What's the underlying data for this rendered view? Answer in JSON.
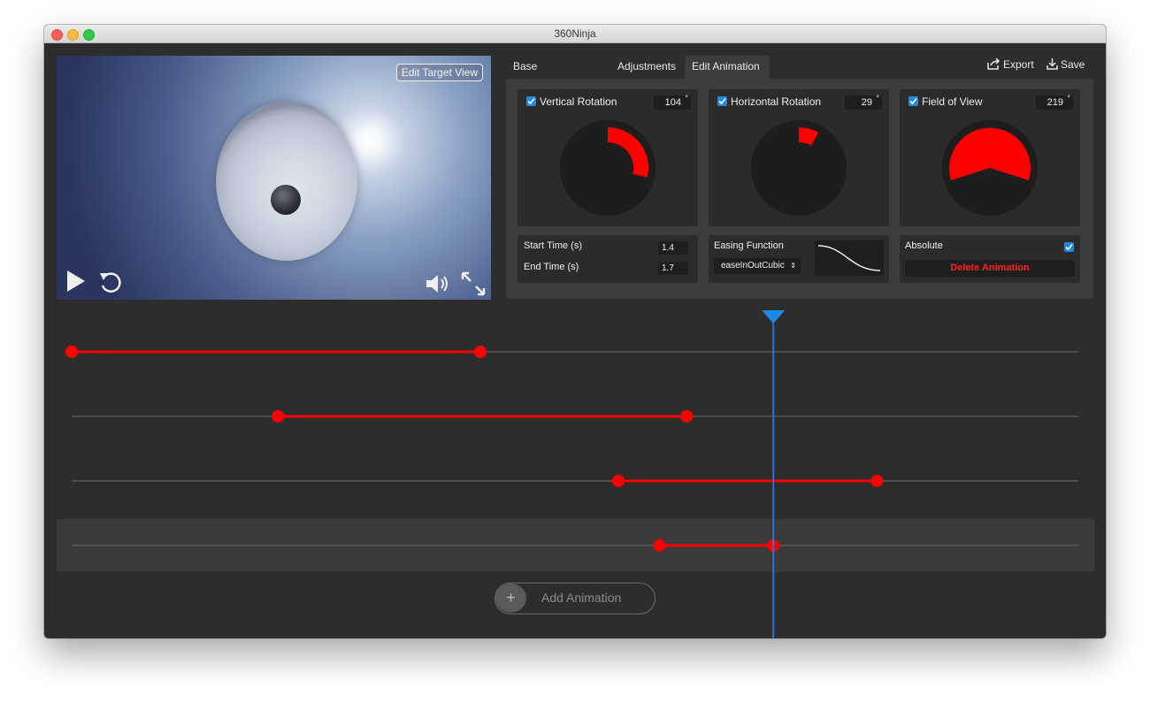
{
  "window": {
    "title": "360Ninja"
  },
  "preview": {
    "edit_target_label": "Edit Target View"
  },
  "tabs": [
    {
      "label": "Base Configuration",
      "active": false
    },
    {
      "label": "Adjustments",
      "active": false
    },
    {
      "label": "Edit Animation",
      "active": true
    }
  ],
  "header_actions": {
    "export_label": "Export",
    "save_label": "Save"
  },
  "dials": [
    {
      "label": "Vertical Rotation",
      "value": "104",
      "unit": "°",
      "checked": true
    },
    {
      "label": "Horizontal Rotation",
      "value": "29",
      "unit": "°",
      "checked": true
    },
    {
      "label": "Field of View",
      "value": "219",
      "unit": "°",
      "checked": true
    }
  ],
  "timing": {
    "start_label": "Start Time (s)",
    "start_value": "1.4",
    "end_label": "End Time (s)",
    "end_value": "1.7"
  },
  "easing": {
    "label": "Easing Function",
    "selected": "easeInOutCubic"
  },
  "absolute": {
    "label": "Absolute",
    "checked": true,
    "delete_label": "Delete Animation"
  },
  "timeline": {
    "playhead_fraction": 0.697,
    "selected_track": 3,
    "tracks": [
      {
        "start": 0.0,
        "end": 0.406
      },
      {
        "start": 0.205,
        "end": 0.611
      },
      {
        "start": 0.543,
        "end": 0.8
      },
      {
        "start": 0.584,
        "end": 0.697
      }
    ]
  },
  "add_animation": {
    "label": "Add Animation",
    "icon": "+"
  },
  "colors": {
    "accent_red": "#ff0000",
    "playhead_blue": "#1e88e5"
  }
}
